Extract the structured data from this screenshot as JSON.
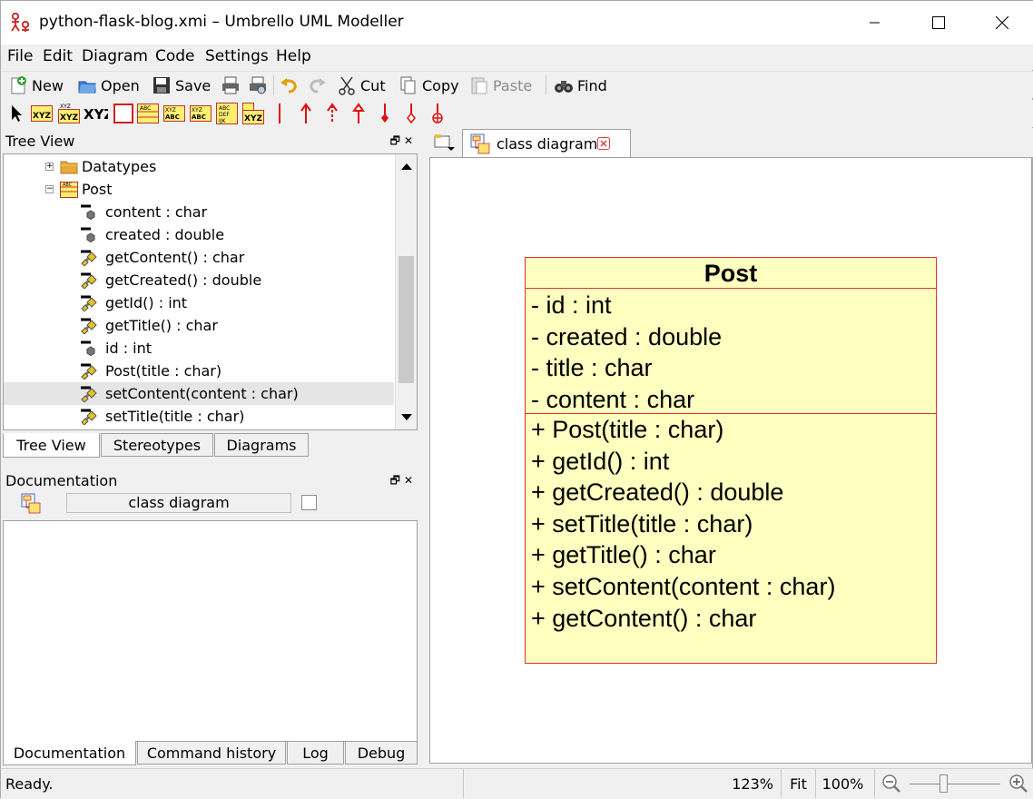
{
  "window": {
    "title": "python-flask-blog.xmi – Umbrello UML Modeller"
  },
  "menu": [
    "File",
    "Edit",
    "Diagram",
    "Code",
    "Settings",
    "Help"
  ],
  "toolbar": {
    "new": "New",
    "open": "Open",
    "save": "Save",
    "cut": "Cut",
    "copy": "Copy",
    "paste": "Paste",
    "find": "Find"
  },
  "tree_dock": {
    "title": "Tree View",
    "rows": [
      {
        "label": "Datatypes",
        "icon": "folder-icon"
      },
      {
        "label": "Post",
        "icon": "class-icon"
      },
      {
        "label": "content : char",
        "icon": "attribute-icon"
      },
      {
        "label": "created : double",
        "icon": "attribute-icon"
      },
      {
        "label": "getContent() : char",
        "icon": "operation-icon"
      },
      {
        "label": "getCreated() : double",
        "icon": "operation-icon"
      },
      {
        "label": "getId() : int",
        "icon": "operation-icon"
      },
      {
        "label": "getTitle() : char",
        "icon": "operation-icon"
      },
      {
        "label": "id : int",
        "icon": "attribute-icon"
      },
      {
        "label": "Post(title : char)",
        "icon": "operation-icon"
      },
      {
        "label": "setContent(content : char)",
        "icon": "operation-icon"
      },
      {
        "label": "setTitle(title : char)",
        "icon": "operation-icon"
      }
    ],
    "tabs": [
      "Tree View",
      "Stereotypes",
      "Diagrams"
    ]
  },
  "doc_dock": {
    "title": "Documentation",
    "field": "class diagram",
    "tabs": [
      "Documentation",
      "Command history",
      "Log",
      "Debug"
    ]
  },
  "diagram_tab": {
    "label": "class diagram"
  },
  "uml_class": {
    "name": "Post",
    "attributes": [
      "- id : int",
      "- created : double",
      "- title : char",
      "- content : char"
    ],
    "operations": [
      "+ Post(title : char)",
      "+ getId() : int",
      "+ getCreated() : double",
      "+ setTitle(title : char)",
      "+ getTitle() : char",
      "+ setContent(content : char)",
      "+ getContent() : char"
    ]
  },
  "status": {
    "text": "Ready.",
    "zoom": "123%",
    "fit": "Fit",
    "zoom100": "100%"
  },
  "colors": {
    "class_fill": "#ffffc0",
    "class_border": "#e03030",
    "close_tab": "#e04040"
  }
}
